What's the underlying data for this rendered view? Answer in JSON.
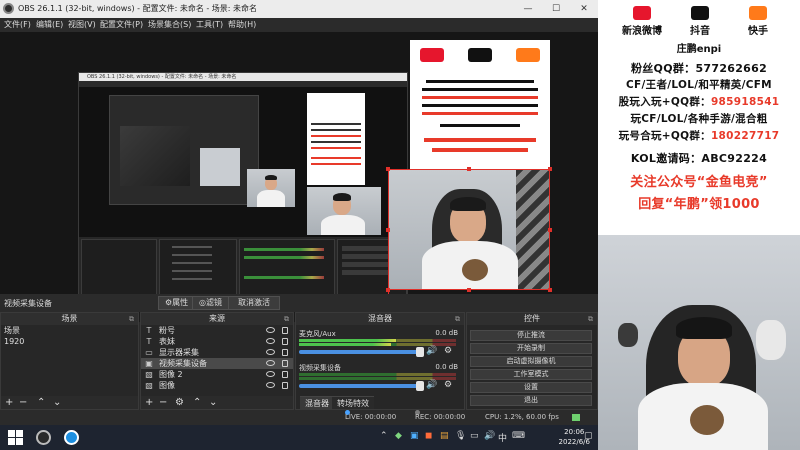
{
  "obs": {
    "title": "OBS 26.1.1 (32-bit, windows) - 配置文件: 未命名 - 场景: 未命名",
    "window_controls": [
      "—",
      "☐",
      "✕"
    ],
    "menu": [
      "文件(F)",
      "编辑(E)",
      "视图(V)",
      "配置文件(P)",
      "场景集合(S)",
      "工具(T)",
      "帮助(H)"
    ],
    "nested_title": "OBS 26.1.1 (32-bit, windows) - 配置文件: 未命名 - 场景: 未命名",
    "info_strip": {
      "source_label": "视频采集设备",
      "properties_button": "⚙属性",
      "filters_button": "◎滤镜",
      "deactivate_button": "取消激活"
    },
    "scenes": {
      "header": "场景",
      "items": [
        "场景",
        "1920"
      ]
    },
    "sources": {
      "header": "来源",
      "items": [
        {
          "icon": "text-icon",
          "glyph": "T",
          "label": "粉号"
        },
        {
          "icon": "text-icon",
          "glyph": "T",
          "label": "表妹"
        },
        {
          "icon": "monitor-icon",
          "glyph": "▭",
          "label": "显示器采集"
        },
        {
          "icon": "camera-icon",
          "glyph": "▣",
          "label": "视频采集设备"
        },
        {
          "icon": "image-icon",
          "glyph": "▧",
          "label": "图像 2"
        },
        {
          "icon": "image-icon",
          "glyph": "▧",
          "label": "图像"
        }
      ]
    },
    "mixer": {
      "header": "混音器",
      "channels": [
        {
          "name": "麦克风/Aux",
          "db": "0.0 dB",
          "level": 0.62
        },
        {
          "name": "视频采集设备",
          "db": "0.0 dB",
          "level": 0.0
        }
      ],
      "tabs": [
        "混音器",
        "转场特效"
      ]
    },
    "controls": {
      "header": "控件",
      "buttons": [
        "停止推流",
        "开始录制",
        "启动虚拟摄像机",
        "工作室模式",
        "设置",
        "退出"
      ]
    },
    "status": {
      "live": "LIVE: 00:00:00",
      "rec": "REC: 00:00:00",
      "cpu": "CPU: 1.2%, 60.00 fps"
    },
    "taskbar": {
      "time": "20:06",
      "date": "2022/6/6",
      "ime": "中"
    }
  },
  "promo": {
    "socials": [
      {
        "label": "新浪微博",
        "color": "#e6162d"
      },
      {
        "label": "抖音",
        "color": "#111111"
      },
      {
        "label": "快手",
        "color": "#ff7a1a"
      }
    ],
    "handle": "庄鹏enpi",
    "qq_group": "粉丝QQ群：577262662",
    "games": "CF/王者/LOL/和平精英/CFM",
    "group1_prefix": "股玩入玩+QQ群：",
    "group1_value": "985918541",
    "group2_prefix": "玩CF/LOL/各种手游/混合粗",
    "group3_prefix": "玩号合玩+QQ群：",
    "group3_value": "180227717",
    "kol": "KOL邀请码：ABC92224",
    "follow": "关注公众号“金鱼电竞”",
    "reply": "回复“年鹏”领1000"
  },
  "colors": {
    "accent_red": "#e83a2a",
    "obs_bg": "#2b2b2b",
    "meter_blue": "#4a90e2"
  }
}
